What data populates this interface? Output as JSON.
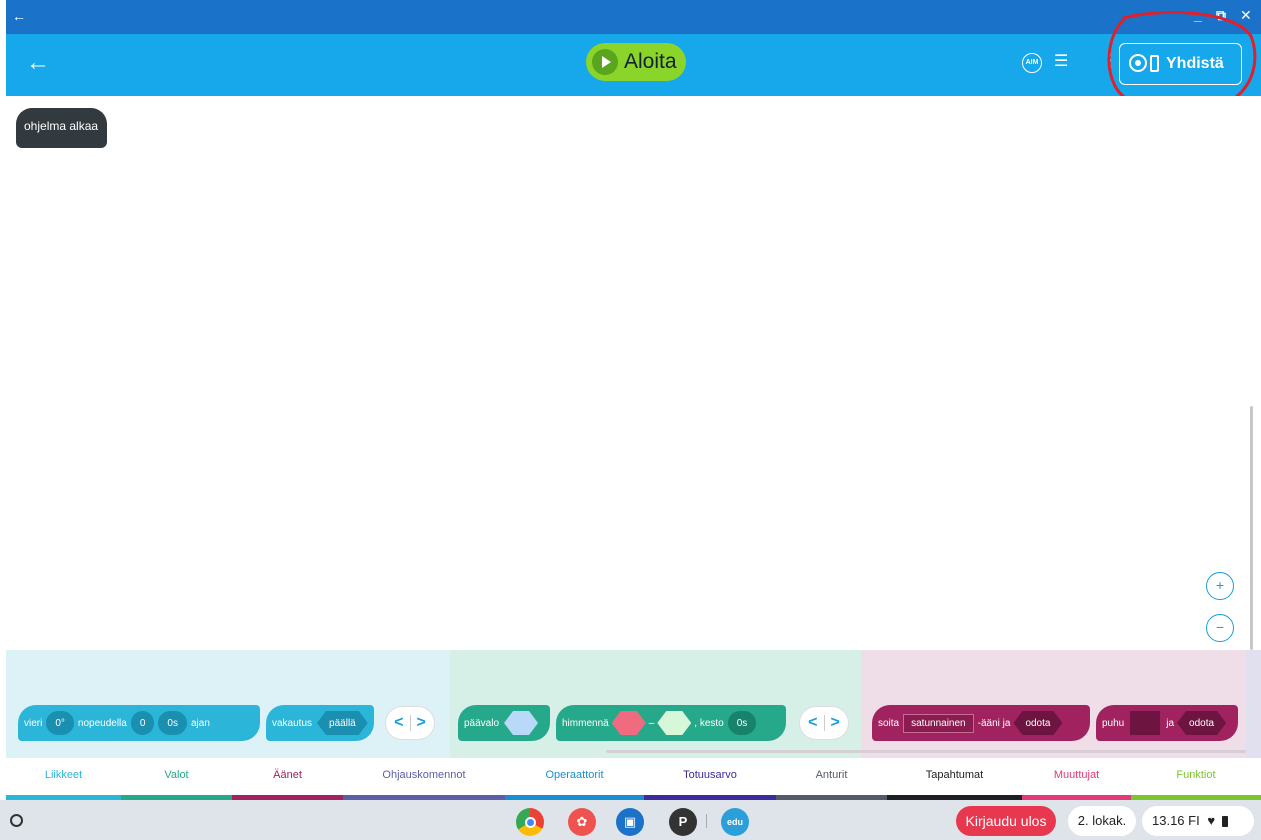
{
  "window": {
    "back_glyph": "←",
    "minimize": "_",
    "restore": "⧉",
    "close": "✕"
  },
  "header": {
    "back_glyph": "←",
    "start_label": "Aloita",
    "aim_label": "AIM",
    "list_glyph": "☰",
    "menu_glyph": "⋮",
    "connect_label": "Yhdistä",
    "annotation_color": "#e0202a"
  },
  "canvas": {
    "start_block_label": "ohjelma alkaa",
    "zoom_in_glyph": "+",
    "zoom_out_glyph": "−"
  },
  "palette": {
    "motion": {
      "roll_label": "vieri",
      "heading_value": "0°",
      "speed_label": "nopeudella",
      "speed_value": "0",
      "time_value": "0s",
      "time_label": "ajan",
      "stabilization_label": "vakautus",
      "stabilization_value": "päällä"
    },
    "lights": {
      "main_led_label": "päävalo",
      "fade_label": "himmennä",
      "fade_sep": "–",
      "duration_label": ", kesto",
      "duration_value": "0s"
    },
    "sounds": {
      "play_label": "soita",
      "sound_value": "satunnainen",
      "sound_suffix": "-ääni ja",
      "wait_value": "odota",
      "speak_label": "puhu",
      "speak_and": "ja",
      "speak_wait": "odota"
    },
    "nav_left": "<",
    "nav_right": ">"
  },
  "tabs": [
    {
      "label": "Liikkeet",
      "color": "#2bb6d9"
    },
    {
      "label": "Valot",
      "color": "#26a98a"
    },
    {
      "label": "Äänet",
      "color": "#a0235f"
    },
    {
      "label": "Ohjauskomennot",
      "color": "#5b5fa6"
    },
    {
      "label": "Operaattorit",
      "color": "#1a8fd0"
    },
    {
      "label": "Totuusarvo",
      "color": "#3d2b9e"
    },
    {
      "label": "Anturit",
      "color": "#555b66"
    },
    {
      "label": "Tapahtumat",
      "color": "#1d1f22"
    },
    {
      "label": "Muuttujat",
      "color": "#e23a78"
    },
    {
      "label": "Funktiot",
      "color": "#7bc62f"
    }
  ],
  "shelf": {
    "apps": [
      {
        "name": "chrome-icon",
        "label": ""
      },
      {
        "name": "paint-icon",
        "label": ""
      },
      {
        "name": "slides-icon",
        "label": ""
      },
      {
        "name": "profile-icon",
        "label": "P"
      },
      {
        "name": "edu-icon",
        "label": "edu"
      }
    ],
    "logout_label": "Kirjaudu ulos",
    "date_label": "2. lokak.",
    "time_label": "13.16 FI"
  }
}
